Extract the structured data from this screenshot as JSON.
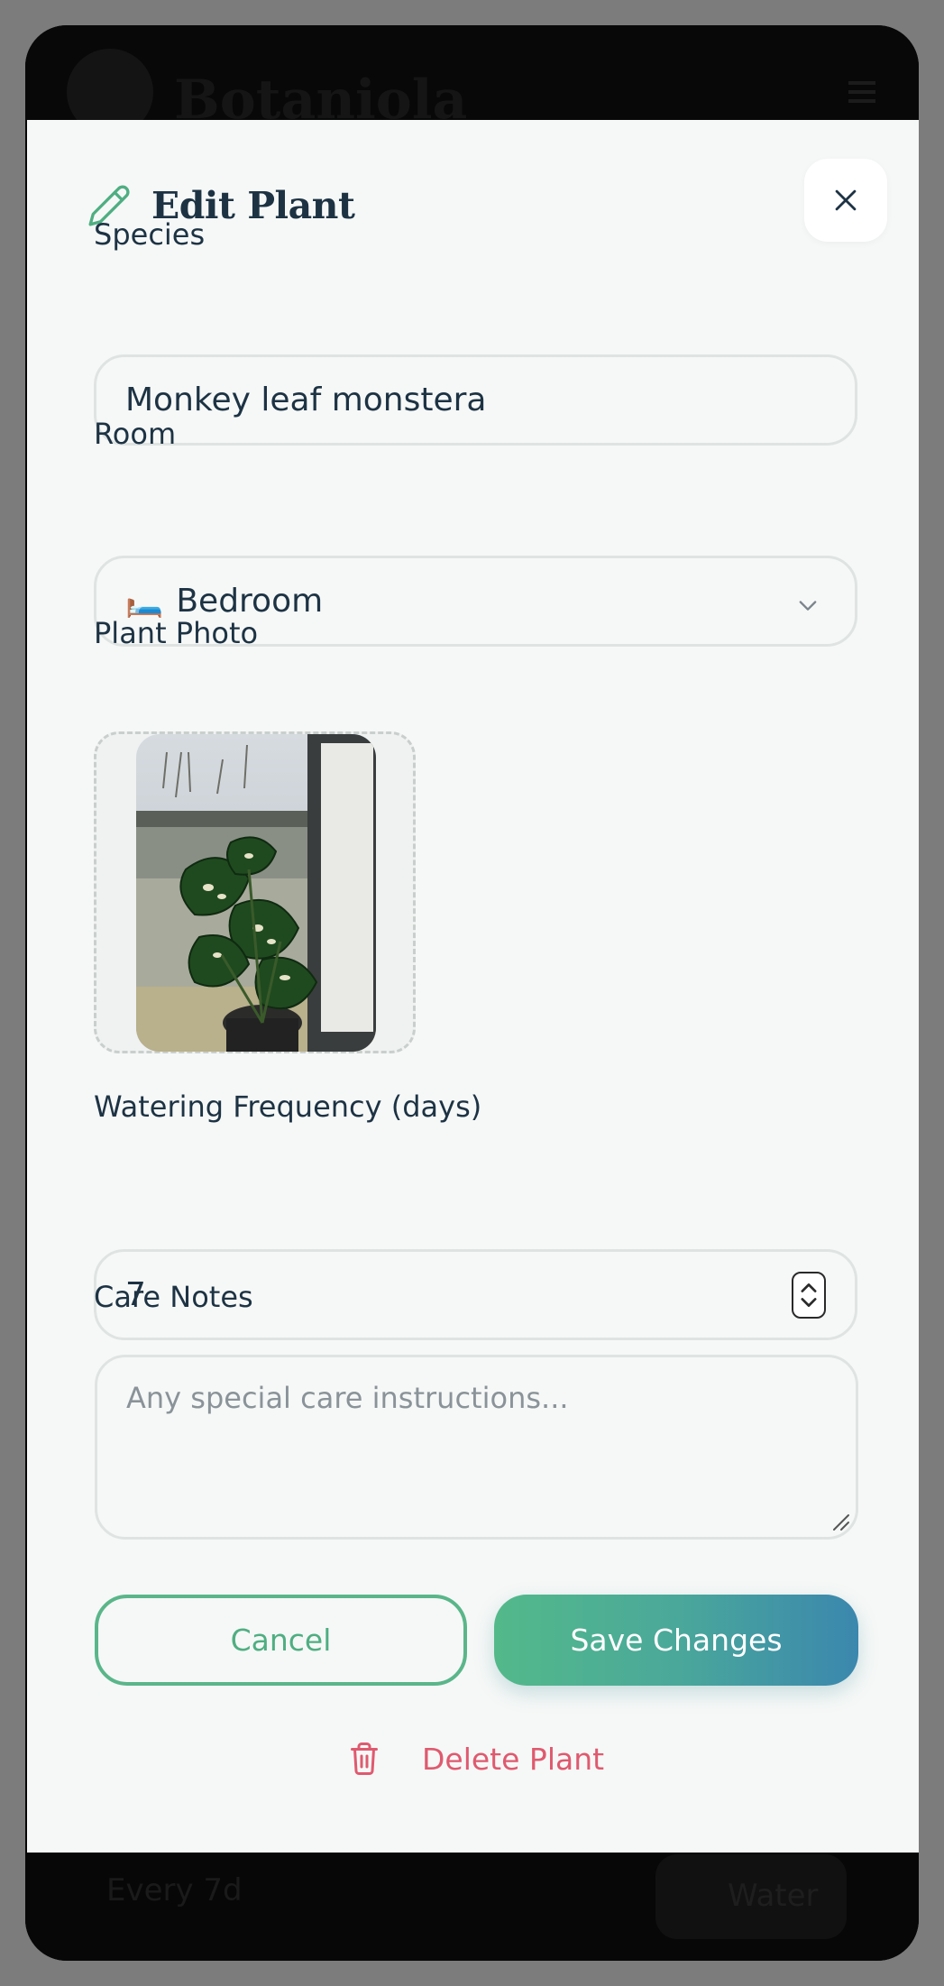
{
  "background": {
    "brand": "Botaniola",
    "footer_text": "Every 7d",
    "footer_button": "Water"
  },
  "modal": {
    "title": "Edit Plant",
    "title_icon": "pencil-icon",
    "close_icon": "close-icon"
  },
  "form": {
    "species": {
      "label": "Species",
      "value": "Monkey leaf monstera"
    },
    "room": {
      "label": "Room",
      "emoji": "🛏️",
      "value": "Bedroom"
    },
    "photo": {
      "label": "Plant Photo"
    },
    "watering": {
      "label": "Watering Frequency (days)",
      "value": "7"
    },
    "notes": {
      "label": "Care Notes",
      "placeholder": "Any special care instructions..."
    }
  },
  "actions": {
    "cancel": "Cancel",
    "save": "Save Changes",
    "delete": "Delete Plant"
  },
  "colors": {
    "accent_green": "#5ab68a",
    "accent_blue": "#3b87ae",
    "danger": "#df5a6f",
    "text_dark": "#1d3344"
  }
}
